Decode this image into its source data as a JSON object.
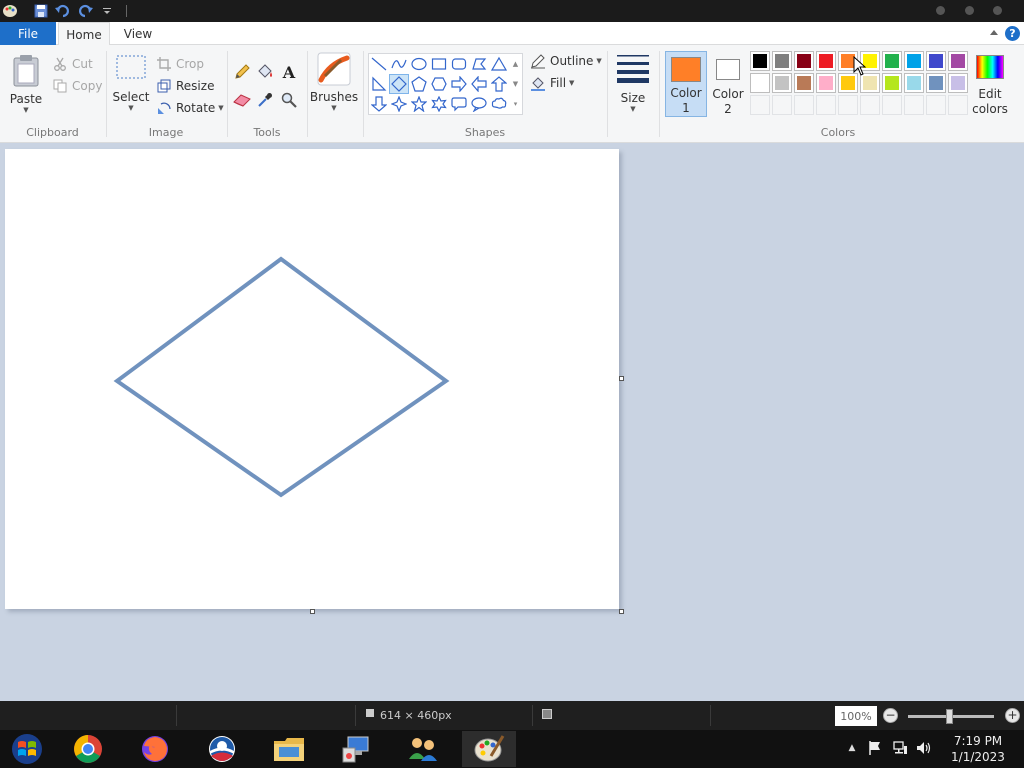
{
  "quick_access": {
    "app_icon": "paint-app-icon",
    "save_icon": "save-icon",
    "undo_icon": "undo-icon",
    "redo_icon": "redo-icon",
    "customize_icon": "customize-quick-access-icon"
  },
  "tabs": {
    "file": "File",
    "home": "Home",
    "view": "View",
    "help": "?"
  },
  "ribbon": {
    "clipboard": {
      "label": "Clipboard",
      "paste": "Paste",
      "cut": "Cut",
      "copy": "Copy"
    },
    "image": {
      "label": "Image",
      "select": "Select",
      "crop": "Crop",
      "resize": "Resize",
      "rotate": "Rotate"
    },
    "tools": {
      "label": "Tools",
      "items": [
        "pencil-icon",
        "fill-bucket-icon",
        "text-icon",
        "eraser-icon",
        "color-picker-icon",
        "magnifier-icon"
      ]
    },
    "brushes": {
      "label": "Brushes"
    },
    "shapes": {
      "label": "Shapes",
      "outline": "Outline",
      "fill": "Fill",
      "items": [
        "line",
        "curve",
        "oval",
        "rectangle",
        "rounded-rectangle",
        "polygon",
        "triangle",
        "right-triangle",
        "diamond",
        "pentagon",
        "hexagon",
        "right-arrow",
        "left-arrow",
        "up-arrow",
        "down-arrow",
        "four-point-star",
        "five-point-star",
        "six-point-star",
        "rounded-callout",
        "oval-callout",
        "cloud-callout"
      ],
      "selected": "diamond"
    },
    "size": {
      "label": "Size"
    },
    "colors": {
      "label": "Colors",
      "color1_label_line1": "Color",
      "color1_label_line2": "1",
      "color1": "#ff7f27",
      "color2_label_line1": "Color",
      "color2_label_line2": "2",
      "color2": "#ffffff",
      "edit_line1": "Edit",
      "edit_line2": "colors",
      "palette_row1": [
        "#000000",
        "#7f7f7f",
        "#880015",
        "#ed1c24",
        "#ff7f27",
        "#fff200",
        "#22b14c",
        "#00a2e8",
        "#3f48cc",
        "#a349a4"
      ],
      "palette_row2": [
        "#ffffff",
        "#c3c3c3",
        "#b97a57",
        "#ffaec9",
        "#ffc90e",
        "#efe4b0",
        "#b5e61d",
        "#99d9ea",
        "#7092be",
        "#c8bfe7"
      ],
      "palette_row3_empty": 10
    }
  },
  "canvas": {
    "drawn_shape": "diamond",
    "stroke_color": "#7092be"
  },
  "status": {
    "dimensions": "614 × 460px",
    "zoom": "100%"
  },
  "taskbar": {
    "apps": [
      "start-button",
      "chrome-icon",
      "firefox-icon",
      "obama-logo-icon",
      "file-explorer-icon",
      "control-panel-icon",
      "network-users-icon",
      "paint-icon"
    ],
    "active": "paint-icon",
    "time": "7:19 PM",
    "date": "1/1/2023"
  }
}
